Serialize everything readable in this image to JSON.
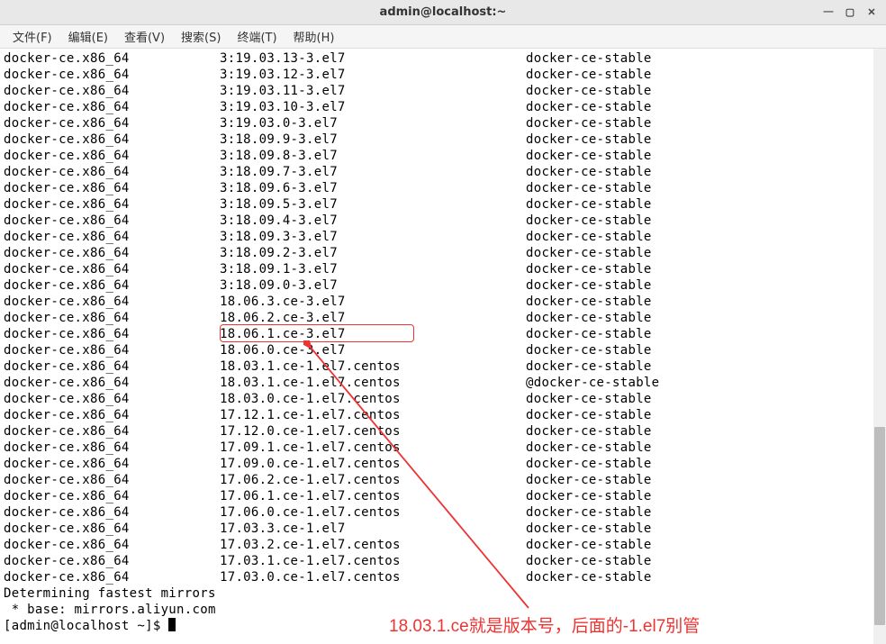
{
  "window": {
    "title": "admin@localhost:~"
  },
  "menu": {
    "file": "文件(F)",
    "edit": "编辑(E)",
    "view": "查看(V)",
    "search": "搜索(S)",
    "terminal": "终端(T)",
    "help": "帮助(H)"
  },
  "packages": [
    {
      "pkg": "docker-ce.x86_64",
      "ver": "3:19.03.13-3.el7",
      "repo": "docker-ce-stable"
    },
    {
      "pkg": "docker-ce.x86_64",
      "ver": "3:19.03.12-3.el7",
      "repo": "docker-ce-stable"
    },
    {
      "pkg": "docker-ce.x86_64",
      "ver": "3:19.03.11-3.el7",
      "repo": "docker-ce-stable"
    },
    {
      "pkg": "docker-ce.x86_64",
      "ver": "3:19.03.10-3.el7",
      "repo": "docker-ce-stable"
    },
    {
      "pkg": "docker-ce.x86_64",
      "ver": "3:19.03.0-3.el7",
      "repo": "docker-ce-stable"
    },
    {
      "pkg": "docker-ce.x86_64",
      "ver": "3:18.09.9-3.el7",
      "repo": "docker-ce-stable"
    },
    {
      "pkg": "docker-ce.x86_64",
      "ver": "3:18.09.8-3.el7",
      "repo": "docker-ce-stable"
    },
    {
      "pkg": "docker-ce.x86_64",
      "ver": "3:18.09.7-3.el7",
      "repo": "docker-ce-stable"
    },
    {
      "pkg": "docker-ce.x86_64",
      "ver": "3:18.09.6-3.el7",
      "repo": "docker-ce-stable"
    },
    {
      "pkg": "docker-ce.x86_64",
      "ver": "3:18.09.5-3.el7",
      "repo": "docker-ce-stable"
    },
    {
      "pkg": "docker-ce.x86_64",
      "ver": "3:18.09.4-3.el7",
      "repo": "docker-ce-stable"
    },
    {
      "pkg": "docker-ce.x86_64",
      "ver": "3:18.09.3-3.el7",
      "repo": "docker-ce-stable"
    },
    {
      "pkg": "docker-ce.x86_64",
      "ver": "3:18.09.2-3.el7",
      "repo": "docker-ce-stable"
    },
    {
      "pkg": "docker-ce.x86_64",
      "ver": "3:18.09.1-3.el7",
      "repo": "docker-ce-stable"
    },
    {
      "pkg": "docker-ce.x86_64",
      "ver": "3:18.09.0-3.el7",
      "repo": "docker-ce-stable"
    },
    {
      "pkg": "docker-ce.x86_64",
      "ver": "18.06.3.ce-3.el7",
      "repo": "docker-ce-stable"
    },
    {
      "pkg": "docker-ce.x86_64",
      "ver": "18.06.2.ce-3.el7",
      "repo": "docker-ce-stable"
    },
    {
      "pkg": "docker-ce.x86_64",
      "ver": "18.06.1.ce-3.el7",
      "repo": "docker-ce-stable"
    },
    {
      "pkg": "docker-ce.x86_64",
      "ver": "18.06.0.ce-3.el7",
      "repo": "docker-ce-stable"
    },
    {
      "pkg": "docker-ce.x86_64",
      "ver": "18.03.1.ce-1.el7.centos",
      "repo": "docker-ce-stable"
    },
    {
      "pkg": "docker-ce.x86_64",
      "ver": "18.03.1.ce-1.el7.centos",
      "repo": "@docker-ce-stable"
    },
    {
      "pkg": "docker-ce.x86_64",
      "ver": "18.03.0.ce-1.el7.centos",
      "repo": "docker-ce-stable"
    },
    {
      "pkg": "docker-ce.x86_64",
      "ver": "17.12.1.ce-1.el7.centos",
      "repo": "docker-ce-stable"
    },
    {
      "pkg": "docker-ce.x86_64",
      "ver": "17.12.0.ce-1.el7.centos",
      "repo": "docker-ce-stable"
    },
    {
      "pkg": "docker-ce.x86_64",
      "ver": "17.09.1.ce-1.el7.centos",
      "repo": "docker-ce-stable"
    },
    {
      "pkg": "docker-ce.x86_64",
      "ver": "17.09.0.ce-1.el7.centos",
      "repo": "docker-ce-stable"
    },
    {
      "pkg": "docker-ce.x86_64",
      "ver": "17.06.2.ce-1.el7.centos",
      "repo": "docker-ce-stable"
    },
    {
      "pkg": "docker-ce.x86_64",
      "ver": "17.06.1.ce-1.el7.centos",
      "repo": "docker-ce-stable"
    },
    {
      "pkg": "docker-ce.x86_64",
      "ver": "17.06.0.ce-1.el7.centos",
      "repo": "docker-ce-stable"
    },
    {
      "pkg": "docker-ce.x86_64",
      "ver": "17.03.3.ce-1.el7",
      "repo": "docker-ce-stable"
    },
    {
      "pkg": "docker-ce.x86_64",
      "ver": "17.03.2.ce-1.el7.centos",
      "repo": "docker-ce-stable"
    },
    {
      "pkg": "docker-ce.x86_64",
      "ver": "17.03.1.ce-1.el7.centos",
      "repo": "docker-ce-stable"
    },
    {
      "pkg": "docker-ce.x86_64",
      "ver": "17.03.0.ce-1.el7.centos",
      "repo": "docker-ce-stable"
    }
  ],
  "footer": {
    "line1": "Determining fastest mirrors",
    "line2": " * base: mirrors.aliyun.com",
    "prompt": "[admin@localhost ~]$ "
  },
  "annotation": "18.03.1.ce就是版本号，后面的-1.el7别管"
}
